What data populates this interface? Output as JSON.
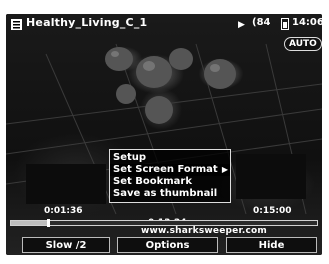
{
  "top_bar": {
    "title": "Healthy_Living_C_1",
    "status": "(84",
    "clock": "14:06",
    "mode_badge": "AUTO"
  },
  "context_menu": {
    "items": [
      {
        "label": "Setup",
        "selected": false
      },
      {
        "label": "Set Screen Format",
        "selected": true,
        "has_submenu": true
      },
      {
        "label": "Set Bookmark",
        "selected": false
      },
      {
        "label": "Save as thumbnail",
        "selected": false
      }
    ]
  },
  "playback": {
    "elapsed": "0:01:36",
    "current": "0:13:24",
    "remaining": "0:15:00",
    "progress": 0.12
  },
  "watermark": "www.sharksweeper.com",
  "soft_keys": {
    "left": "Slow /2",
    "middle": "Options",
    "right": "Hide"
  }
}
